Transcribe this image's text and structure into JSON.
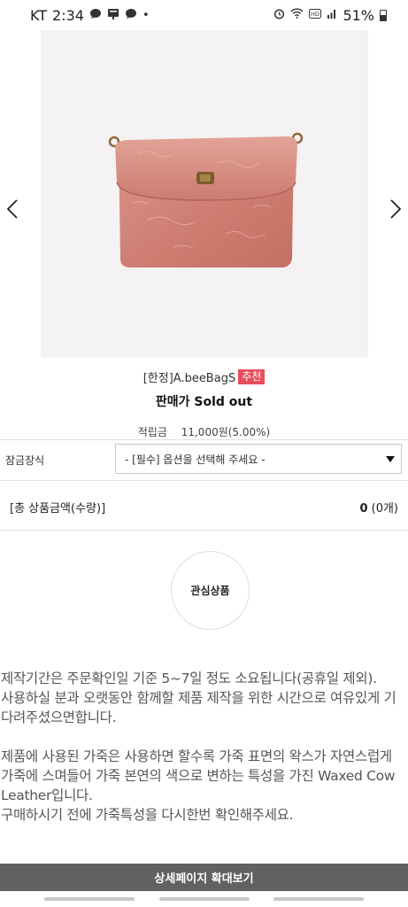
{
  "status_bar": {
    "carrier": "KT",
    "time": "2:34",
    "notification_dot": "•",
    "battery": "51%"
  },
  "product": {
    "image_alt": "Leather crossbody bag",
    "brand": "[한정]A.beeBagS",
    "badge": "추천",
    "price_label": "판매가",
    "price_value": "Sold out",
    "points_label": "적립금",
    "points_value": "11,000원(5.00%)"
  },
  "options": {
    "label": "잠금장식",
    "select_text": "- [필수] 옵션을 선택해 주세요 -"
  },
  "total": {
    "label": "[총 상품금액(수량)]",
    "amount": "0",
    "qty": "(0개)"
  },
  "wishlist": {
    "label": "관심상품"
  },
  "notice": {
    "para1": "제작기간은 주문확인일 기준 5~7일 정도 소요됩니다(공휴일 제외).",
    "para2": "사용하실 분과 오랫동안 함께할 제품 제작을 위한 시간으로 여유있게 기다려주셨으면합니다.",
    "para3": "제품에 사용된 가죽은 사용하면 할수록 가죽 표면의 왁스가 자연스럽게 가죽에 스며들어 가죽 본연의 색으로 변하는 특성을 가진 Waxed Cow Leather입니다.",
    "para4": "구매하시기 전에 가죽특성을 다시한번 확인해주세요."
  },
  "detail_button": {
    "label": "상세페이지 확대보기"
  },
  "colors": {
    "badge": "#e84d5b",
    "button_bg": "#616161",
    "leather": "#d4857a"
  }
}
